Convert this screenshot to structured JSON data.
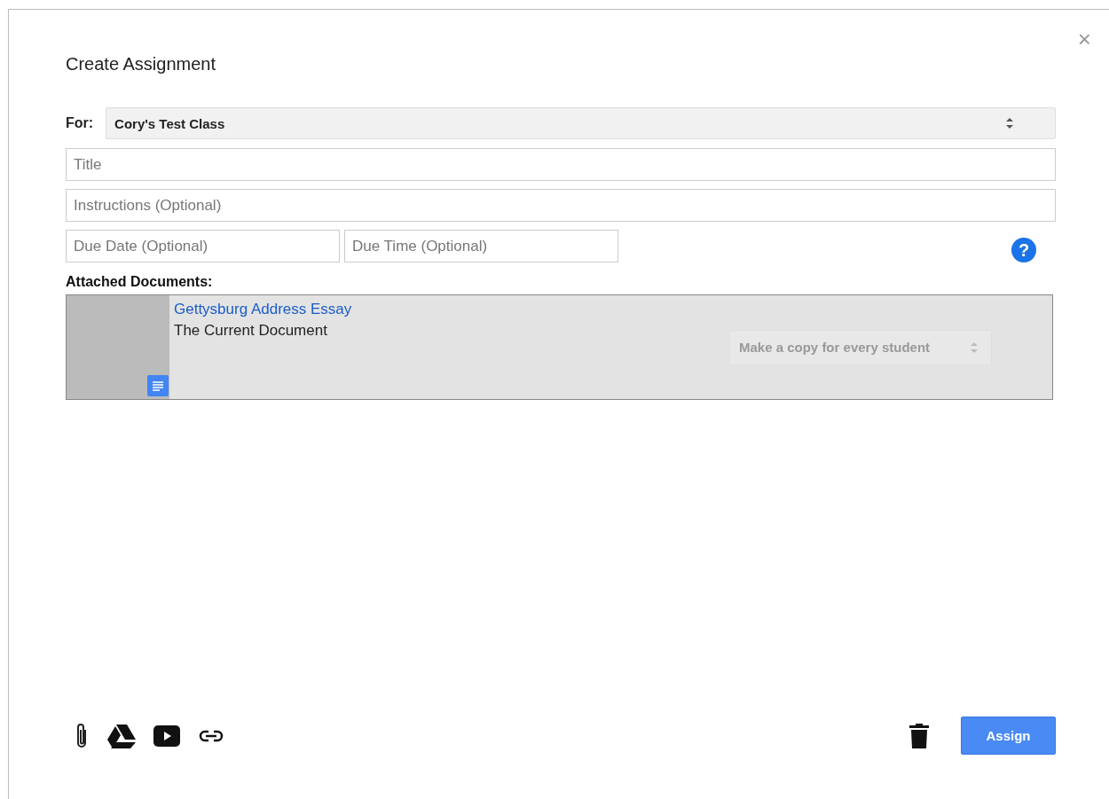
{
  "dialog": {
    "title": "Create Assignment",
    "close": "×"
  },
  "for": {
    "label": "For:",
    "value": "Cory's Test Class"
  },
  "fields": [
    {
      "placeholder": "Title"
    },
    {
      "placeholder": "Instructions (Optional)"
    }
  ],
  "due_date": {
    "placeholder": "Due Date (Optional)"
  },
  "due_time": {
    "placeholder": "Due Time (Optional)"
  },
  "help": "?",
  "attachments_label": "Attached Documents:",
  "attachments": [
    {
      "name": "Gettysburg Address Essay",
      "subtitle": "The Current Document",
      "share_option": "Make a copy for every student",
      "disabled": true
    }
  ],
  "footer": {
    "assign": "Assign"
  }
}
